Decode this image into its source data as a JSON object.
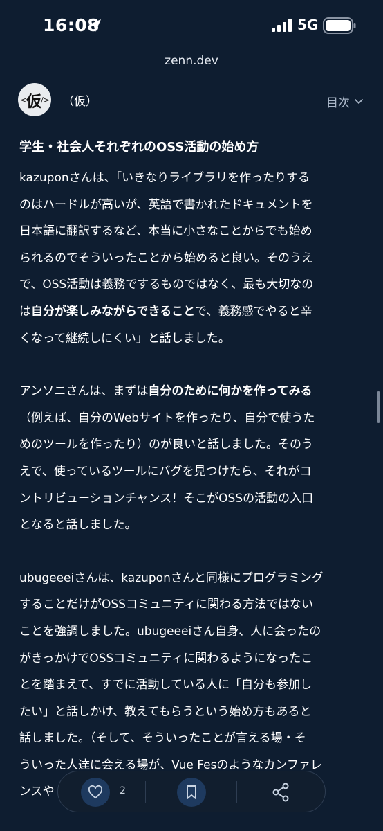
{
  "status_bar": {
    "time": "16:08",
    "network": "5G",
    "icons": [
      "location-arrow-icon",
      "signal-icon",
      "battery-icon"
    ]
  },
  "browser": {
    "url": "zenn.dev"
  },
  "site_header": {
    "logo": {
      "kanji": "仮",
      "left": "<",
      "right": "/>"
    },
    "name": "（仮）",
    "toc_label": "目次",
    "toc_icon": "chevron-down-icon"
  },
  "article": {
    "heading": "学生・社会人それぞれのOSS活動の始め方",
    "paragraphs": [
      {
        "lines": [
          "kazuponさんは、「いきなりライブラリを作ったりする",
          "のはハードルが高いが、英語で書かれたドキュメントを",
          "日本語に翻訳するなど、本当に小さなことからでも始め",
          "られるのでそういったことから始めると良い。そのうえ",
          "で、OSS活動は義務でするものではなく、最も大切なの"
        ],
        "line6_pre": "は",
        "line6_bold": "自分が楽しみながらできること",
        "line6_post": "で、義務感でやると辛",
        "line7": "くなって継続しにくい」と話しました。"
      },
      {
        "line1_pre": "アンソニさんは、まずは",
        "line1_bold": "自分のために何かを作ってみる",
        "lines": [
          "（例えば、自分のWebサイトを作ったり、自分で使うた",
          "めのツールを作ったり）のが良いと話しました。そのう",
          "えで、使っているツールにバグを見つけたら、それがコ",
          "ントリビューションチャンス！そこがOSSの活動の入口",
          "となると話しました。"
        ]
      },
      {
        "lines": [
          "ubugeeeiさんは、kazuponさんと同様にプログラミング",
          "することだけがOSSコミュニティに関わる方法ではない",
          "ことを強調しました。ubugeeeiさん自身、人に会ったの",
          "がきっかけでOSSコミュニティに関わるようになったこ",
          "とを踏まえて、すでに活動している人に「自分も参加し",
          "たい」と話しかけ、教えてもらうという始め方もあると",
          "話しました。（そして、そういったことが言える場・そ",
          "ういった人達に会える場が、Vue Fesのようなカンファレ",
          "ンスや"
        ]
      }
    ]
  },
  "action_bar": {
    "like_count": "2",
    "icons": [
      "heart-icon",
      "bookmark-icon",
      "share-icon"
    ]
  }
}
